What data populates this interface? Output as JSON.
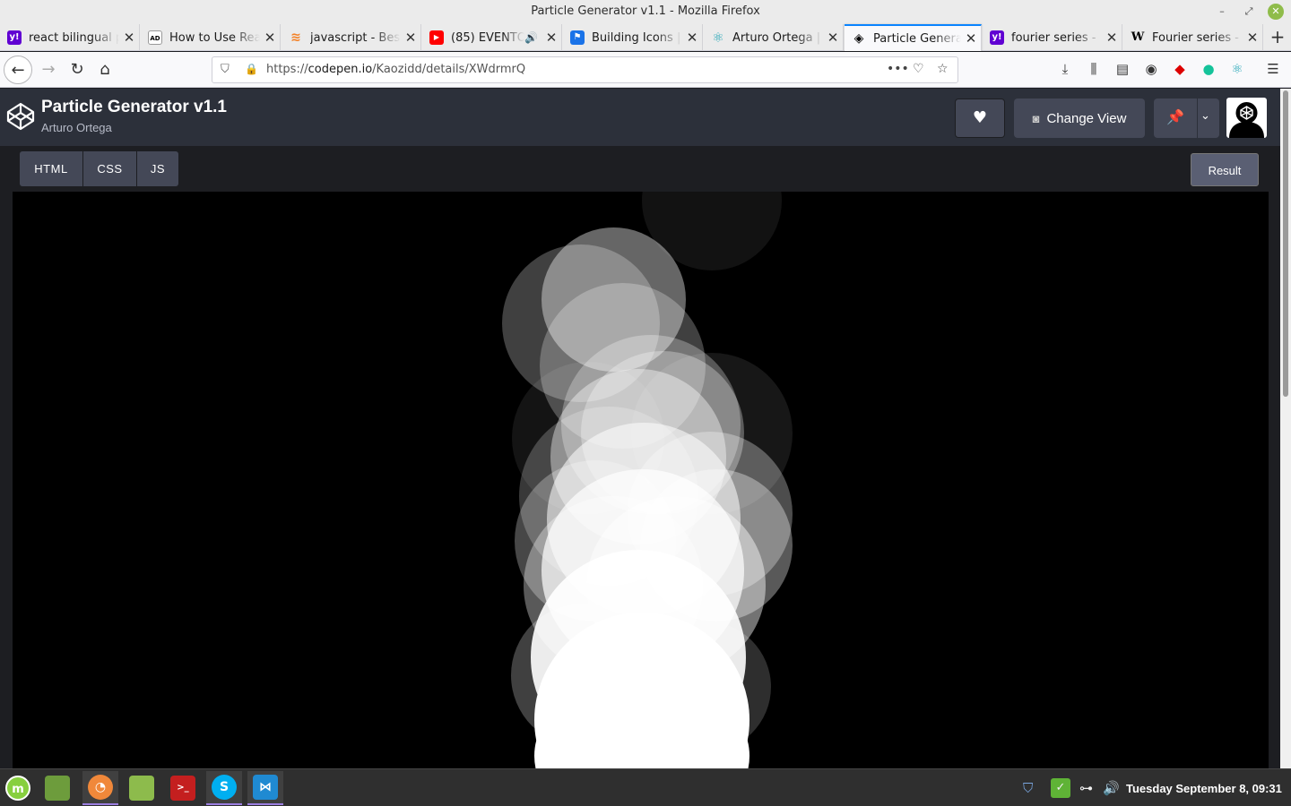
{
  "window": {
    "title": "Particle Generator v1.1 - Mozilla Firefox"
  },
  "tabs": [
    {
      "label": "react bilingual p",
      "icon": "yahoo-icon",
      "color": "#6001d2"
    },
    {
      "label": "How to Use Rea",
      "icon": "ad-icon",
      "color": "#ffffff"
    },
    {
      "label": "javascript - Best",
      "icon": "stackoverflow-icon",
      "color": "#f48024"
    },
    {
      "label": "(85) EVENTO",
      "icon": "youtube-icon",
      "color": "#ff0000"
    },
    {
      "label": "Building Icons | ",
      "icon": "flag-icon",
      "color": "#1a73e8"
    },
    {
      "label": "Arturo Ortega |",
      "icon": "react-icon",
      "color": "#2aa8b8"
    },
    {
      "label": "Particle Genera",
      "icon": "codepen-icon",
      "color": "#000000",
      "active": true
    },
    {
      "label": "fourier series - ",
      "icon": "yahoo-icon",
      "color": "#6001d2"
    },
    {
      "label": "Fourier series - W",
      "icon": "wikipedia-icon",
      "color": "#ffffff"
    }
  ],
  "nav": {
    "url_prefix": "https://",
    "url_host": "codepen.io",
    "url_path": "/Kaozidd/details/XWdrmrQ"
  },
  "codepen": {
    "title": "Particle Generator v1.1",
    "author": "Arturo Ortega",
    "change_view_label": "Change View",
    "editor_tabs": [
      "HTML",
      "CSS",
      "JS"
    ],
    "result_label": "Result"
  },
  "taskbar": {
    "clock": "Tuesday September  8, 09:31",
    "apps": [
      "mint-menu-icon",
      "files-icon",
      "firefox-icon",
      "folder-icon",
      "terminal-icon",
      "skype-icon",
      "vscode-icon"
    ]
  }
}
